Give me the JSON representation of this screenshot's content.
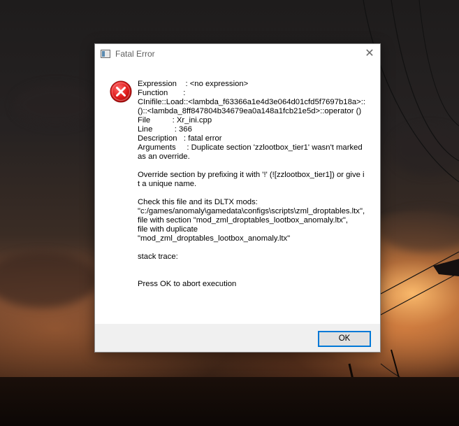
{
  "window": {
    "title": "Fatal Error",
    "close_glyph": "✕",
    "app_icon": "window-app-icon",
    "error_icon": "error-x-icon",
    "error_icon_color": "#e81123"
  },
  "message": {
    "text": "Expression    : <no expression>\nFunction       :\nCInifile::Load::<lambda_f63366a1e4d3e064d01cfd5f7697b18a>::()::<lambda_8ff847804b34679ea0a148a1fcb21e5d>::operator ()\nFile          : Xr_ini.cpp\nLine          : 366\nDescription   : fatal error\nArguments     : Duplicate section 'zzlootbox_tier1' wasn't marked as an override.\n\nOverride section by prefixing it with '!' (![zzlootbox_tier1]) or give it a unique name.\n\nCheck this file and its DLTX mods:\n\"c:/games/anomaly\\gamedata\\configs\\scripts\\zml_droptables.ltx\",\nfile with section \"mod_zml_droptables_lootbox_anomaly.ltx\",\nfile with duplicate\n\"mod_zml_droptables_lootbox_anomaly.ltx\"\n\nstack trace:\n\n\nPress OK to abort execution"
  },
  "buttons": {
    "ok_label": "OK"
  },
  "colors": {
    "accent": "#0078d7",
    "footer_bg": "#f0f0f0"
  }
}
